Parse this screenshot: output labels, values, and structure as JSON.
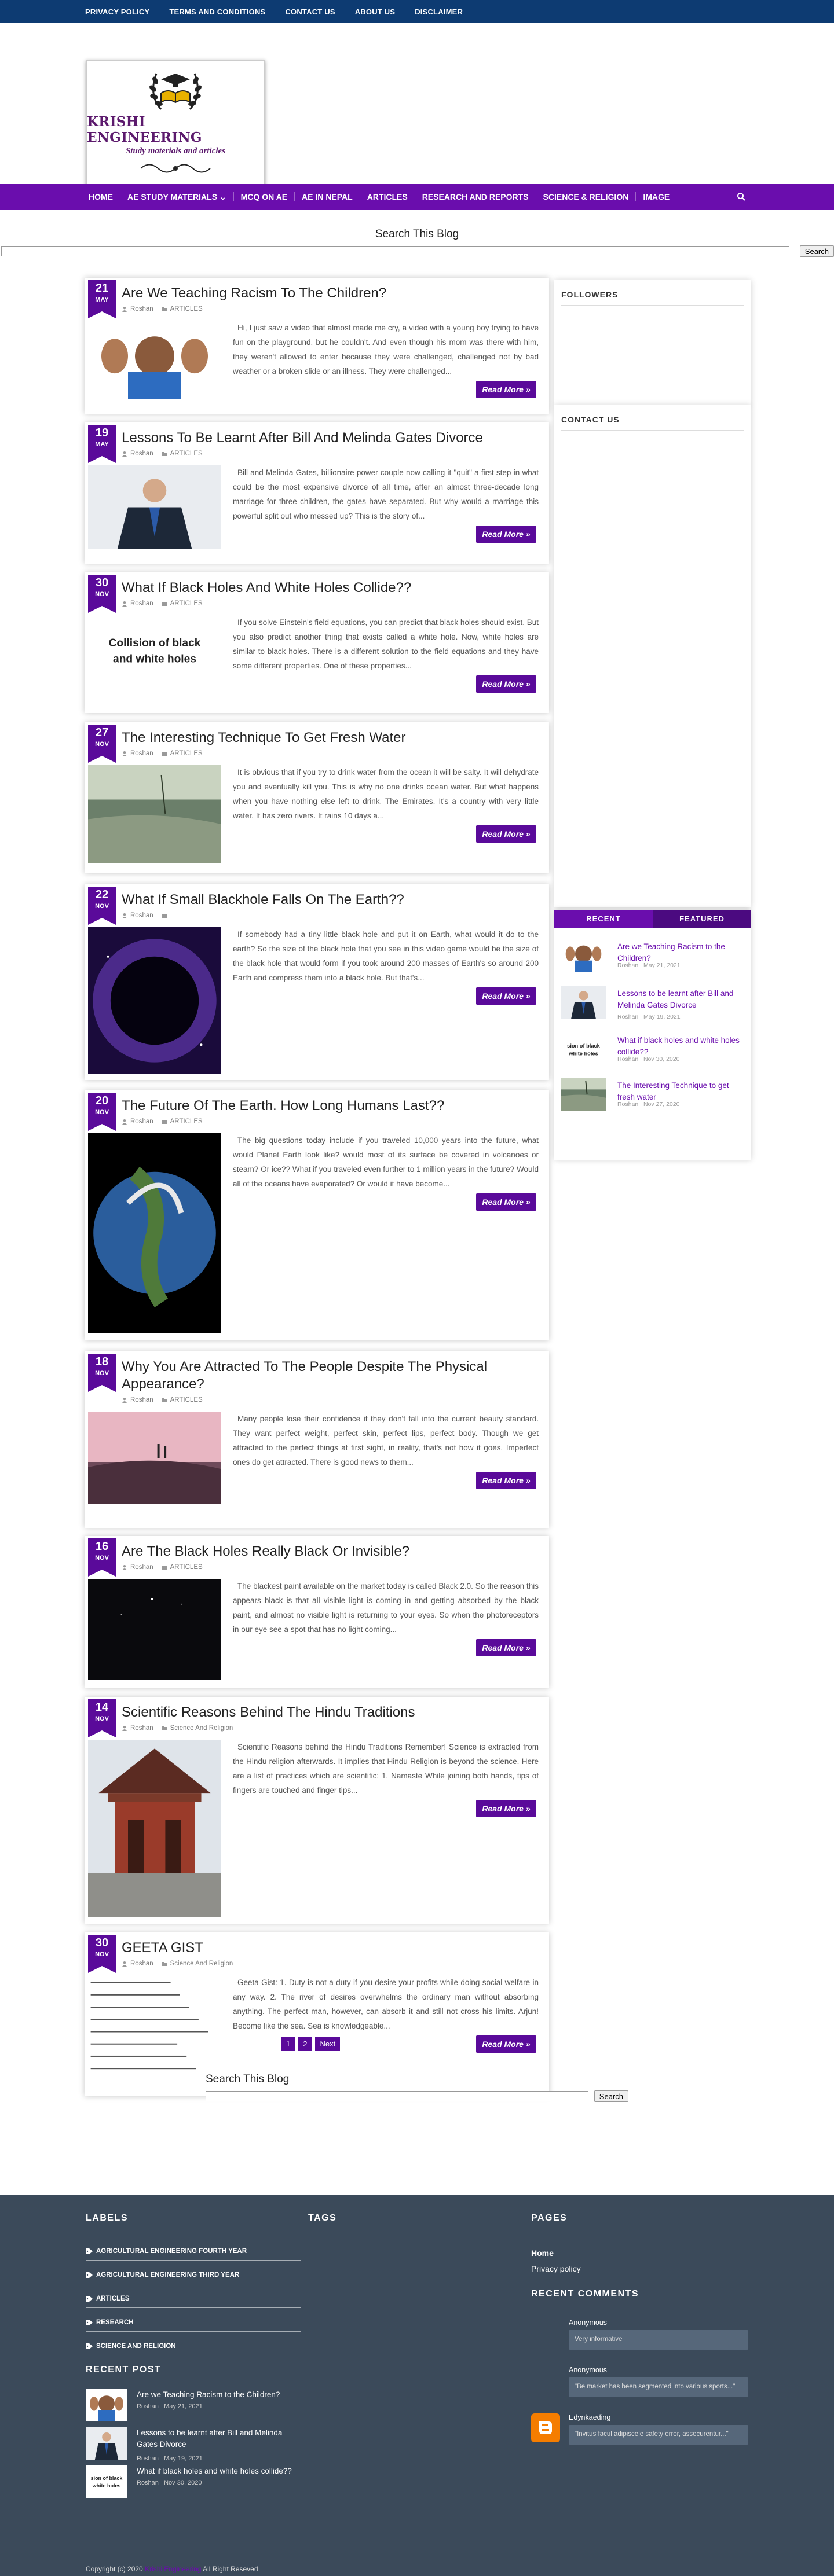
{
  "topnav": [
    "PRIVACY POLICY",
    "TERMS AND CONDITIONS",
    "CONTACT US",
    "ABOUT US",
    "DISCLAIMER"
  ],
  "logo": {
    "title": "KRISHI ENGINEERING",
    "subtitle": "Study materials and articles"
  },
  "mainnav": [
    "HOME",
    "AE STUDY MATERIALS ⌄",
    "MCQ ON AE",
    "AE IN NEPAL",
    "ARTICLES",
    "RESEARCH AND REPORTS",
    "SCIENCE & RELIGION",
    "IMAGE"
  ],
  "search": {
    "title": "Search This Blog",
    "button": "Search"
  },
  "posts": [
    {
      "day": "21",
      "month": "MAY",
      "title": "Are We Teaching Racism To The Children?",
      "author": "Roshan",
      "category": "ARTICLES",
      "excerpt": "Hi, I just saw a video that almost made me cry, a video with a young boy trying to have fun on the playground, but he couldn't. And even though his mom was there with him, they weren't allowed to enter because they were challenged, challenged not by bad weather or a broken slide or an illness. They were challenged...",
      "more": "Read More »",
      "thumb": "racism"
    },
    {
      "day": "19",
      "month": "MAY",
      "title": "Lessons To Be Learnt After Bill And Melinda Gates Divorce",
      "author": "Roshan",
      "category": "ARTICLES",
      "excerpt": "Bill and Melinda Gates, billionaire power couple now calling it \"quit\" a first step in what could be the most expensive divorce of all time, after an almost three-decade long marriage for three children, the gates have separated. But why would a marriage this powerful split out who messed up? This is the story of...",
      "more": "Read More »",
      "thumb": "gates"
    },
    {
      "day": "30",
      "month": "NOV",
      "title": "What If Black Holes And White Holes Collide??",
      "author": "Roshan",
      "category": "ARTICLES",
      "excerpt": "If you solve Einstein's field equations, you can predict that black holes should exist. But you also predict another thing that exists called a white hole. Now, white holes are similar to black holes. There is a different solution to the field equations and they have some different properties. One of these properties...",
      "more": "Read More »",
      "thumb": "collision",
      "thumbText": "Collision of black and white holes"
    },
    {
      "day": "27",
      "month": "NOV",
      "title": "The Interesting Technique To Get Fresh Water",
      "author": "Roshan",
      "category": "ARTICLES",
      "excerpt": "It is obvious that if you try to drink water from the ocean it will be salty. It will dehydrate you and eventually kill you. This is why no one drinks ocean water. But what happens when you have nothing else left to drink. The Emirates. It's a country with very little water. It has zero rivers. It rains 10 days a...",
      "more": "Read More »",
      "thumb": "water"
    },
    {
      "day": "22",
      "month": "NOV",
      "title": "What If Small Blackhole Falls On The Earth??",
      "author": "Roshan",
      "category": "",
      "excerpt": "If somebody had a tiny little black hole and put it on Earth, what would it do to the earth? So the size of the black hole that you see in this video game would be the size of the black hole that would form if you took around 200 masses of Earth's so around 200 Earth and compress them into a black hole. But that's...",
      "more": "Read More »",
      "thumb": "blackhole"
    },
    {
      "day": "20",
      "month": "NOV",
      "title": "The Future Of The Earth. How Long Humans Last??",
      "author": "Roshan",
      "category": "ARTICLES",
      "excerpt": "The big questions today include if you traveled 10,000 years into the future, what would Planet Earth look like? would most of its surface be covered in volcanoes or steam? Or ice?? What if you traveled even further to 1 million years in the future? Would all of the oceans have evaporated? Or would it have become...",
      "more": "Read More »",
      "thumb": "earth"
    },
    {
      "day": "18",
      "month": "NOV",
      "title": "Why You Are Attracted To The People Despite The Physical Appearance?",
      "author": "Roshan",
      "category": "ARTICLES",
      "excerpt": "Many people lose their confidence if they don't fall into the current beauty standard. They want perfect weight, perfect skin, perfect lips, perfect body. Though we get attracted to the perfect things at first sight, in reality, that's not how it goes. Imperfect ones do get attracted. There is good news to them...",
      "more": "Read More »",
      "thumb": "sunset"
    },
    {
      "day": "16",
      "month": "NOV",
      "title": "Are The Black Holes Really Black Or Invisible?",
      "author": "Roshan",
      "category": "ARTICLES",
      "excerpt": "The blackest paint available on the market today is called Black 2.0. So the reason this appears black is that all visible light is coming in and getting absorbed by the black paint, and almost no visible light is returning to your eyes. So when the photoreceptors in our eye see a spot that has no light coming...",
      "more": "Read More »",
      "thumb": "dark"
    },
    {
      "day": "14",
      "month": "NOV",
      "title": "Scientific Reasons Behind The Hindu Traditions",
      "author": "Roshan",
      "category": "Science And Religion",
      "excerpt": "Scientific Reasons behind the Hindu Traditions Remember! Science is extracted from the Hindu religion afterwards. It implies that Hindu Religion is beyond the science. Here are a list of practices which are scientific: 1. Namaste While joining both hands, tips of fingers are touched and finger tips...",
      "more": "Read More »",
      "thumb": "temple"
    },
    {
      "day": "30",
      "month": "NOV",
      "title": "GEETA GIST",
      "author": "Roshan",
      "category": "Science And Religion",
      "excerpt": "Geeta Gist: 1. Duty is not a duty if you desire your profits while doing social welfare in any way. 2. The river of desires overwhelms the ordinary man without absorbing anything. The perfect man, however, can absorb it and still not cross his limits. Arjun! Become like the sea. Sea is knowledgeable...",
      "more": "Read More »",
      "thumb": "text"
    }
  ],
  "sidebar": {
    "followers": "FOLLOWERS",
    "contact": "CONTACT US",
    "tabs": [
      "RECENT",
      "FEATURED"
    ],
    "recent": [
      {
        "title": "Are we Teaching Racism to the Children?",
        "author": "Roshan",
        "date": "May 21, 2021",
        "thumb": "racism"
      },
      {
        "title": "Lessons to be learnt after Bill and Melinda Gates Divorce",
        "author": "Roshan",
        "date": "May 19, 2021",
        "thumb": "gates"
      },
      {
        "title": "What if black holes and white holes collide??",
        "author": "Roshan",
        "date": "Nov 30, 2020",
        "thumb": "collision",
        "thumbText": "sion of black white holes"
      },
      {
        "title": "The Interesting Technique to get fresh water",
        "author": "Roshan",
        "date": "Nov 27, 2020",
        "thumb": "water"
      }
    ]
  },
  "pager": [
    "1",
    "2",
    "Next"
  ],
  "footer": {
    "labels_title": "LABELS",
    "labels": [
      "AGRICULTURAL ENGINEERING FOURTH YEAR",
      "AGRICULTURAL ENGINEERING THIRD YEAR",
      "ARTICLES",
      "RESEARCH",
      "SCIENCE AND RELIGION"
    ],
    "tags_title": "TAGS",
    "pages_title": "PAGES",
    "pages": [
      "Home",
      "Privacy policy"
    ],
    "recent_post_title": "RECENT POST",
    "recent_posts": [
      {
        "title": "Are we Teaching Racism to the Children?",
        "author": "Roshan",
        "date": "May 21, 2021",
        "thumb": "racism"
      },
      {
        "title": "Lessons to be learnt after Bill and Melinda Gates Divorce",
        "author": "Roshan",
        "date": "May 19, 2021",
        "thumb": "gates"
      },
      {
        "title": "What if black holes and white holes collide??",
        "author": "Roshan",
        "date": "Nov 30, 2020",
        "thumb": "collision",
        "thumbText": "sion of black white holes"
      }
    ],
    "comments_title": "RECENT COMMENTS",
    "comments": [
      {
        "name": "Anonymous",
        "body": "Very informative"
      },
      {
        "name": "Anonymous",
        "body": "\"Be market has been segmented into various sports...\""
      },
      {
        "name": "Edynkaeding",
        "body": "\"Invitus facul adipiscele safety error, assecurentur...\""
      }
    ],
    "copyright_prefix": "Copyright (c) 2020",
    "copyright_brand": "Krishi Engineering",
    "copyright_suffix": "All Right Reseved"
  }
}
